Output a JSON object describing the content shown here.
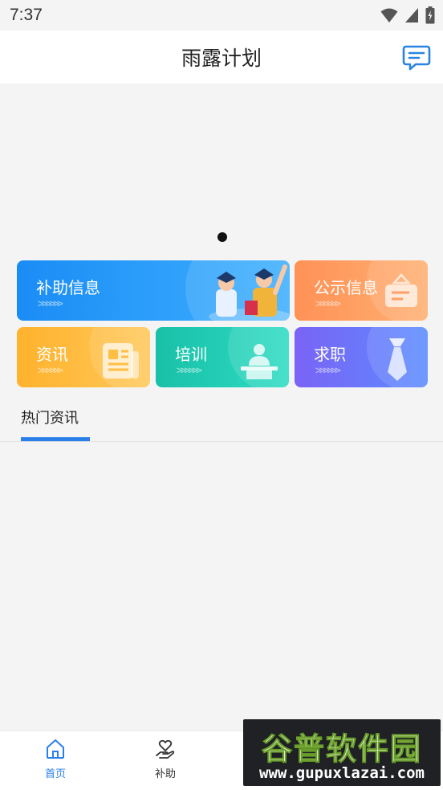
{
  "status_bar": {
    "time": "7:37"
  },
  "header": {
    "title": "雨露计划",
    "message_icon": "message-icon"
  },
  "banner": {
    "page_indicator": "dot"
  },
  "tiles": {
    "subsidy": {
      "label": "补助信息",
      "arrows": ">>>>>>"
    },
    "public": {
      "label": "公示信息",
      "arrows": ">>>>>>"
    },
    "news": {
      "label": "资讯",
      "arrows": ">>>>>>"
    },
    "training": {
      "label": "培训",
      "arrows": ">>>>>>"
    },
    "job": {
      "label": "求职",
      "arrows": ">>>>>>"
    }
  },
  "section_tabs": {
    "hot_news": "热门资讯"
  },
  "bottom_nav": {
    "items": [
      {
        "label": "首页",
        "icon": "home-icon",
        "active": true
      },
      {
        "label": "补助",
        "icon": "heart-hand-icon",
        "active": false
      }
    ]
  },
  "watermark": {
    "title": "谷普软件园",
    "url": "www.gupuxlazai.com"
  },
  "colors": {
    "accent": "#2a7fe8",
    "subsidy": "#1a8cf5",
    "public": "#ff9156",
    "news": "#ffb22c",
    "training": "#19c0a8",
    "job": "#7a63f6"
  }
}
